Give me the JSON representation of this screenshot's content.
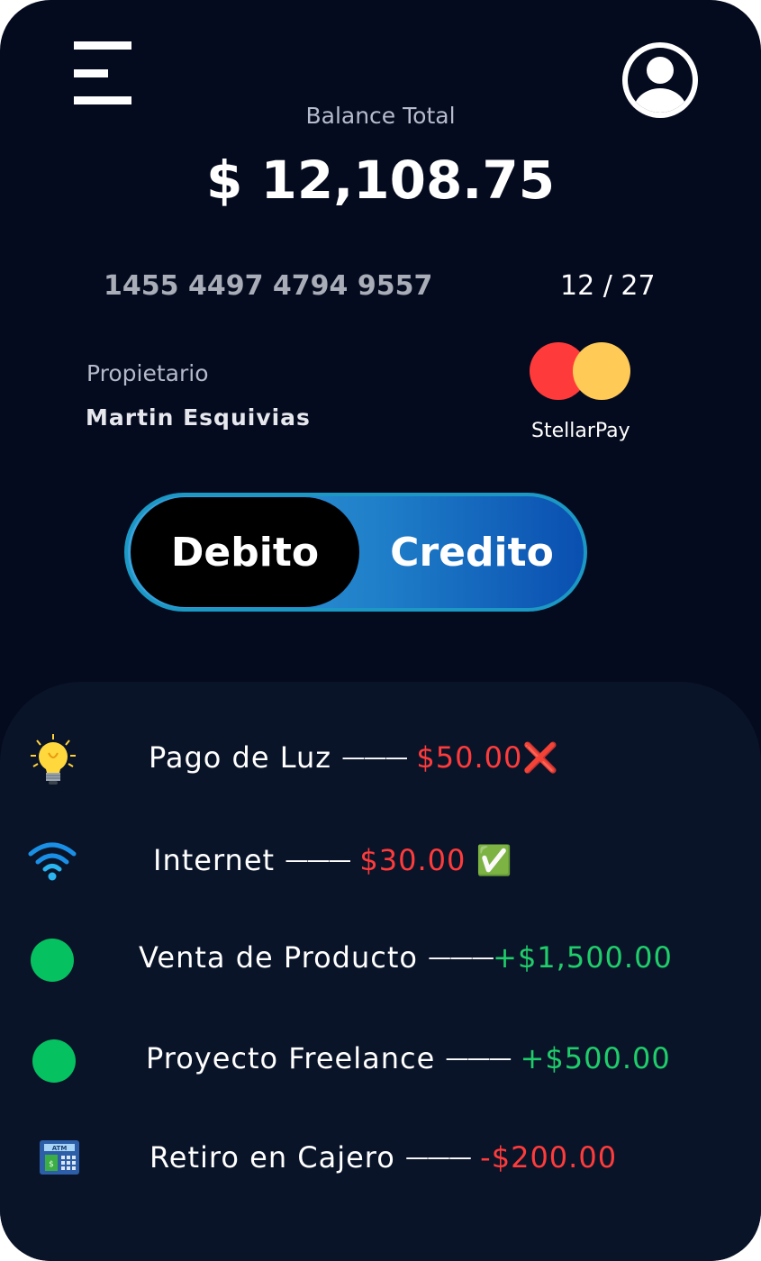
{
  "header": {
    "menu_icon": "hamburger-menu-icon",
    "avatar_icon": "user-avatar-icon"
  },
  "balance": {
    "label": "Balance Total",
    "amount": "$ 12,108.75"
  },
  "card": {
    "number": "1455 4497 4794 9557",
    "expiry": "12 / 27",
    "owner_label": "Propietario",
    "owner_name": "Martin Esquivias",
    "brand_name": "StellarPay",
    "brand_colors": [
      "#ff3a3a",
      "#ffca55"
    ]
  },
  "toggle": {
    "debito_label": "Debito",
    "credito_label": "Credito",
    "selected": "Debito"
  },
  "transactions": [
    {
      "icon": "lightbulb-icon",
      "name": "Pago de Luz",
      "dash": "———",
      "amount": "$50.00",
      "status": "❌",
      "type": "negative"
    },
    {
      "icon": "wifi-icon",
      "name": "Internet",
      "dash": "———",
      "amount": "$30.00",
      "status": "✅",
      "type": "negative"
    },
    {
      "icon": "green-dot-icon",
      "name": "Venta de Producto",
      "dash": "———",
      "amount": "+$1,500.00",
      "status": "",
      "type": "positive"
    },
    {
      "icon": "green-dot-icon",
      "name": "Proyecto Freelance",
      "dash": "———",
      "amount": "+$500.00",
      "status": "",
      "type": "positive"
    },
    {
      "icon": "atm-icon",
      "name": "Retiro en Cajero",
      "dash": "———",
      "amount": "-$200.00",
      "status": "",
      "type": "negative"
    }
  ],
  "colors": {
    "background": "#050b1f",
    "panel": "#0a1429",
    "negative": "#ff3b3b",
    "positive": "#1fce6a",
    "toggle_accent": "#1c98c4"
  }
}
